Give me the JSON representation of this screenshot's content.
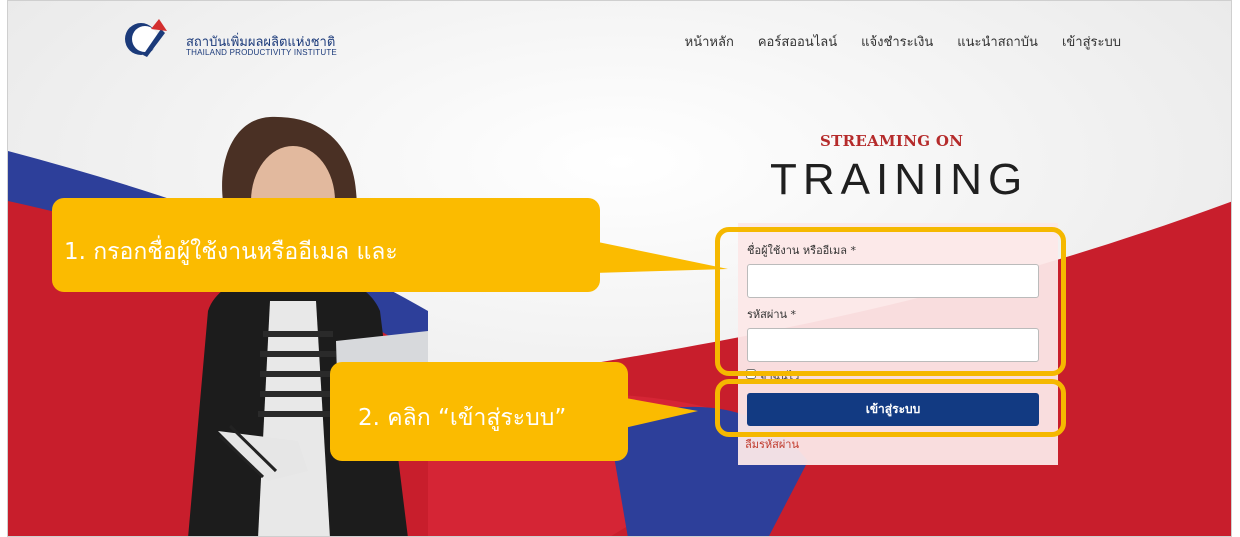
{
  "header": {
    "logo_th": "สถาบันเพิ่มผลผลิตแห่งชาติ",
    "logo_en": "THAILAND PRODUCTIVITY INSTITUTE",
    "menu": [
      "หน้าหลัก",
      "คอร์สออนไลน์",
      "แจ้งชำระเงิน",
      "แนะนำสถาบัน",
      "เข้าสู่ระบบ"
    ]
  },
  "hero": {
    "streaming": "STREAMING ON",
    "training": "TRAINING"
  },
  "login": {
    "username_label": "ชื่อผู้ใช้งาน หรืออีเมล *",
    "password_label": "รหัสผ่าน *",
    "remember_label": "จำฉันไว้",
    "submit_label": "เข้าสู่ระบบ",
    "forgot_label": "ลืมรหัสผ่าน"
  },
  "annotations": {
    "step1": "1. กรอกชื่อผู้ใช้งานหรืออีเมล และ",
    "step2": "2. คลิก “เข้าสู่ระบบ”"
  },
  "colors": {
    "brand_blue": "#123a82",
    "brand_red": "#c8102e",
    "callout": "#fbbb00"
  }
}
